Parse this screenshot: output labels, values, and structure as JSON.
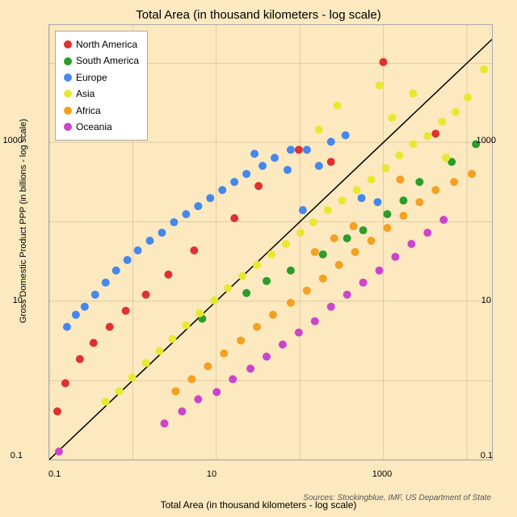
{
  "title": "Total Area (in thousand kilometers - log scale)",
  "xAxisLabel": "Total Area (in thousand kilometers - log scale)",
  "yAxisLabel": "Gross Domestic Product PPP (in billions - log scale)",
  "sourceText": "Sources: Stockingblue, IMF, US Department of State",
  "xTicks": [
    "0.1",
    "10",
    "1000"
  ],
  "yTicks": [
    "0.1",
    "10",
    "1000"
  ],
  "legend": {
    "items": [
      {
        "label": "North America",
        "color": "#e03030"
      },
      {
        "label": "South America",
        "color": "#2a9e2a"
      },
      {
        "label": "Europe",
        "color": "#4488ee"
      },
      {
        "label": "Asia",
        "color": "#f0f050"
      },
      {
        "label": "Africa",
        "color": "#f5a020"
      },
      {
        "label": "Oceania",
        "color": "#cc44cc"
      }
    ]
  },
  "colors": {
    "background": "#fce9c0",
    "gridline": "#ddbbaa"
  }
}
